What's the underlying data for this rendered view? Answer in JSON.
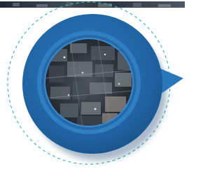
{
  "colors": {
    "background": "#ffffff",
    "disc": "#1f62a0",
    "disc_shadow": "#0d3a6b",
    "inner_ring": "#2f7fc2",
    "dashed_ring": "#3fb9b0",
    "pointer": "#2a76bb"
  },
  "graphic": {
    "photo_subject": "aerial-city-photo",
    "pointer_direction": "right"
  }
}
